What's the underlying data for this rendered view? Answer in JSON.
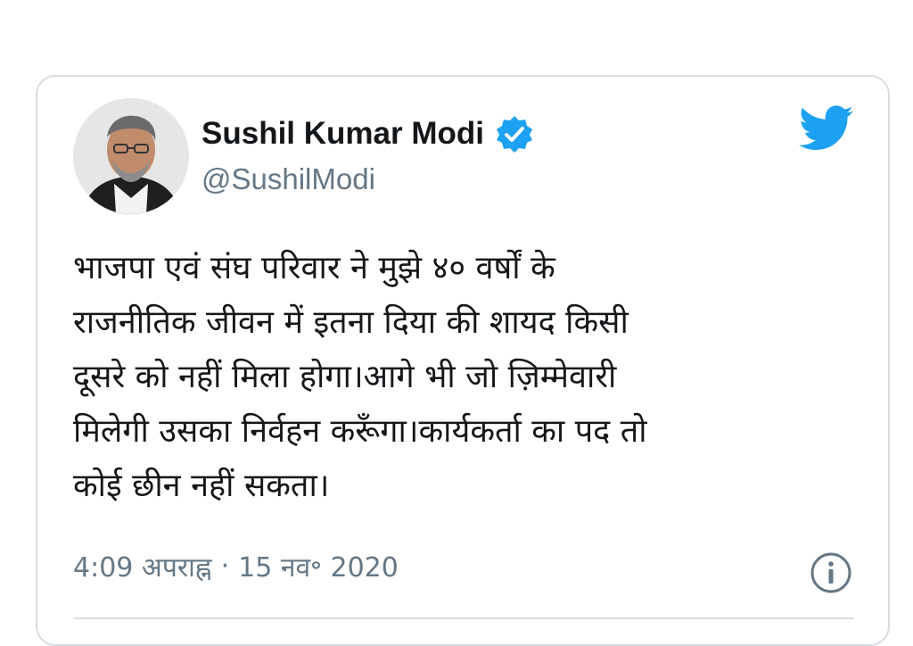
{
  "author": {
    "name": "Sushil Kumar Modi",
    "handle": "@SushilModi",
    "verified": true,
    "avatar_icon": "profile-photo"
  },
  "tweet": {
    "lines": [
      "भाजपा एवं संघ परिवार ने मुझे ४० वर्षों के",
      "राजनीतिक जीवन में इतना दिया की शायद किसी",
      "दूसरे को नहीं मिला होगा।आगे भी जो ज़िम्मेवारी",
      "मिलेगी उसका निर्वहन करूँगा।कार्यकर्ता का पद तो",
      "कोई छीन नहीं सकता।"
    ],
    "time": "4:09 अपराह्न",
    "separator": "·",
    "date": "15 नव॰ 2020"
  },
  "colors": {
    "brand": "#1DA1F2",
    "text": "#14171a",
    "muted": "#657786",
    "border": "#d6dde3"
  },
  "icons": {
    "brand": "twitter-bird-icon",
    "verified": "verified-badge-icon",
    "info": "info-icon"
  }
}
